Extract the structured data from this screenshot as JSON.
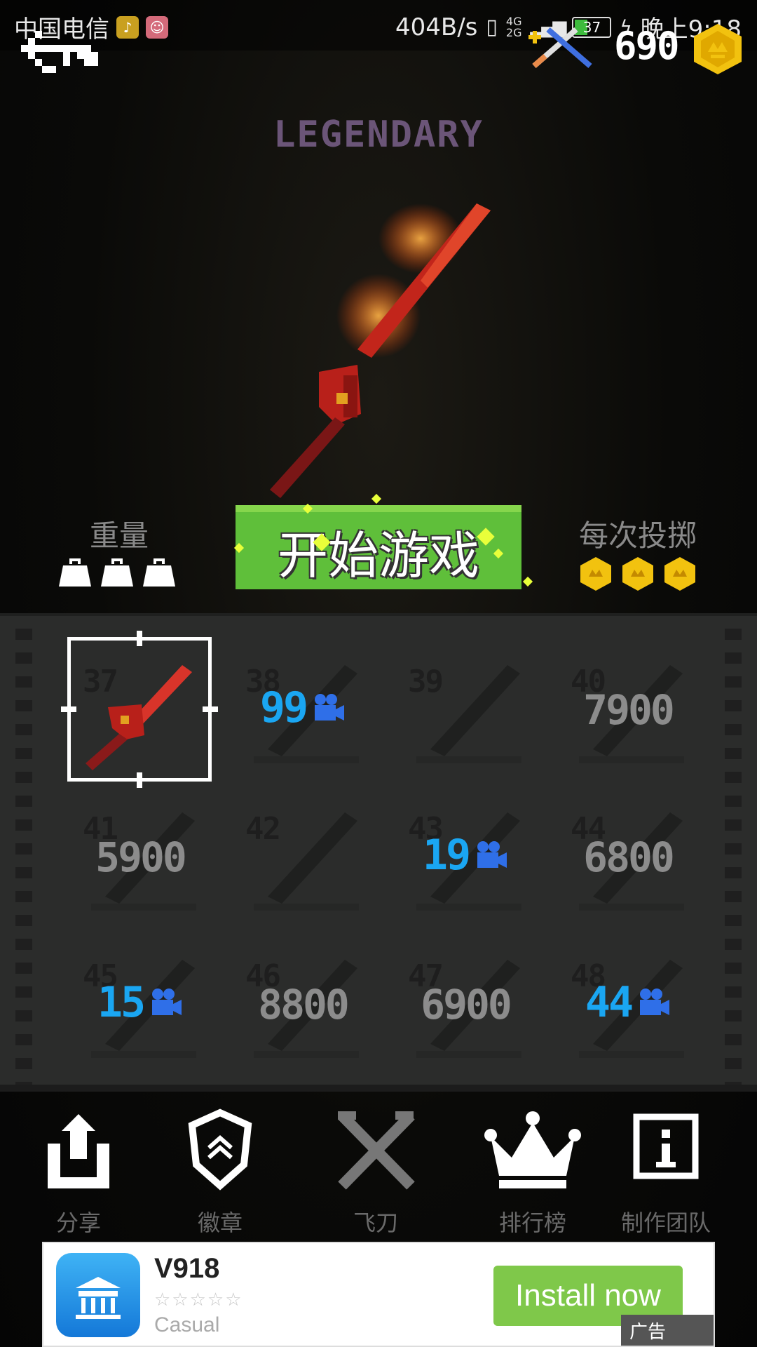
{
  "status_bar": {
    "carrier": "中国电信",
    "net_speed": "404B/s",
    "net_type_top": "4G",
    "net_type_bottom": "2G",
    "battery": "37",
    "time": "晚上9:18"
  },
  "header": {
    "coins": "690",
    "rarity": "LEGENDARY"
  },
  "stats": {
    "weight_label": "重量",
    "weight_level": 3,
    "per_throw_label": "每次投掷",
    "per_throw_coins": 3
  },
  "start_button": "开始游戏",
  "knives": [
    {
      "num": "37",
      "price": "",
      "video": "",
      "selected": true
    },
    {
      "num": "38",
      "price": "",
      "video": "99"
    },
    {
      "num": "39",
      "price": "",
      "video": ""
    },
    {
      "num": "40",
      "price": "7900",
      "video": ""
    },
    {
      "num": "41",
      "price": "5900",
      "video": ""
    },
    {
      "num": "42",
      "price": "",
      "video": ""
    },
    {
      "num": "43",
      "price": "",
      "video": "19"
    },
    {
      "num": "44",
      "price": "6800",
      "video": ""
    },
    {
      "num": "45",
      "price": "",
      "video": "15"
    },
    {
      "num": "46",
      "price": "8800",
      "video": ""
    },
    {
      "num": "47",
      "price": "6900",
      "video": ""
    },
    {
      "num": "48",
      "price": "",
      "video": "44"
    }
  ],
  "nav": {
    "share": "分享",
    "badges": "徽章",
    "knives": "飞刀",
    "leaderboard": "排行榜",
    "credits": "制作团队"
  },
  "ad": {
    "app_name": "V918",
    "category": "Casual",
    "button": "Install now",
    "tag": "广告"
  },
  "colors": {
    "start_green": "#5fbf3a",
    "video_blue": "#1aa6f2",
    "coin_gold": "#f2c20f",
    "rarity_purple": "#6b5578"
  }
}
